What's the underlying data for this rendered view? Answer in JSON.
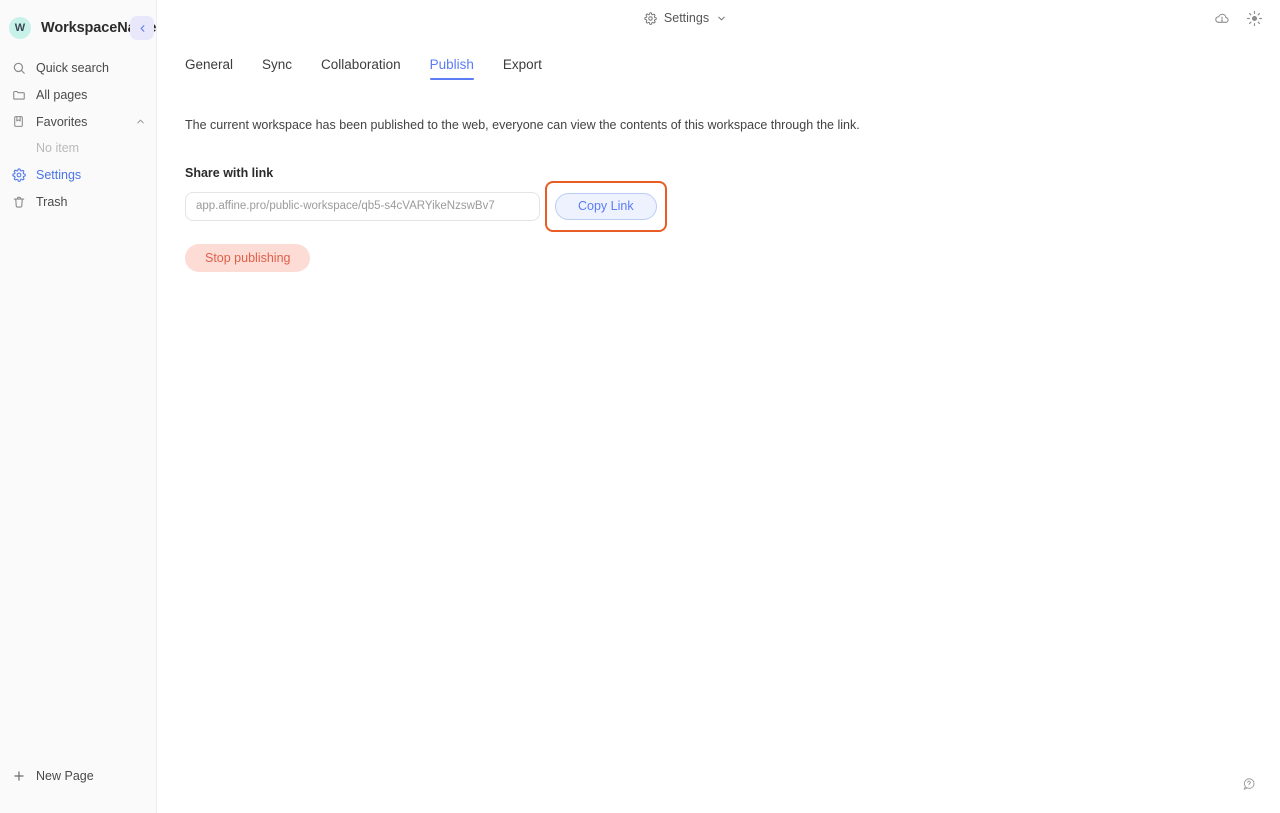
{
  "sidebar": {
    "workspace": {
      "avatar_initial": "W",
      "name": "WorkspaceName",
      "collapse_icon": "chevron-left-icon"
    },
    "items": [
      {
        "label": "Quick search",
        "icon": "search-icon",
        "active": false
      },
      {
        "label": "All pages",
        "icon": "folder-icon",
        "active": false
      },
      {
        "label": "Favorites",
        "icon": "bookmark-icon",
        "active": false,
        "chevron": "chevron-up-icon"
      },
      {
        "label": "Settings",
        "icon": "gear-icon",
        "active": true
      },
      {
        "label": "Trash",
        "icon": "trash-icon",
        "active": false
      }
    ],
    "favorites_empty": "No item",
    "new_page": {
      "label": "New Page",
      "icon": "plus-icon"
    }
  },
  "topbar": {
    "title": "Settings",
    "title_icon": "gear-icon",
    "dropdown_icon": "chevron-down-icon",
    "right_icons": [
      {
        "name": "cloud-sync-icon"
      },
      {
        "name": "sun-brightness-icon"
      }
    ]
  },
  "main": {
    "tabs": [
      {
        "label": "General",
        "active": false
      },
      {
        "label": "Sync",
        "active": false
      },
      {
        "label": "Collaboration",
        "active": false
      },
      {
        "label": "Publish",
        "active": true
      },
      {
        "label": "Export",
        "active": false
      }
    ],
    "description": "The current workspace has been published to the web, everyone can view the contents of this workspace through the link.",
    "share_section_label": "Share with link",
    "link_placeholder": "app.affine.pro/public-workspace/qb5-s4cVARYikeNzswBv7",
    "link_value": "",
    "copy_button_label": "Copy Link",
    "stop_button_label": "Stop publishing"
  },
  "help": {
    "icon": "help-question-icon"
  },
  "colors": {
    "accent_blue": "#5b7cf5",
    "danger_red": "#e0604a",
    "danger_bg": "#fcdcd5",
    "annotation_orange": "#ea5c26",
    "avatar_teal": "#c6f2ea",
    "sidebar_bg": "#fafafa"
  }
}
